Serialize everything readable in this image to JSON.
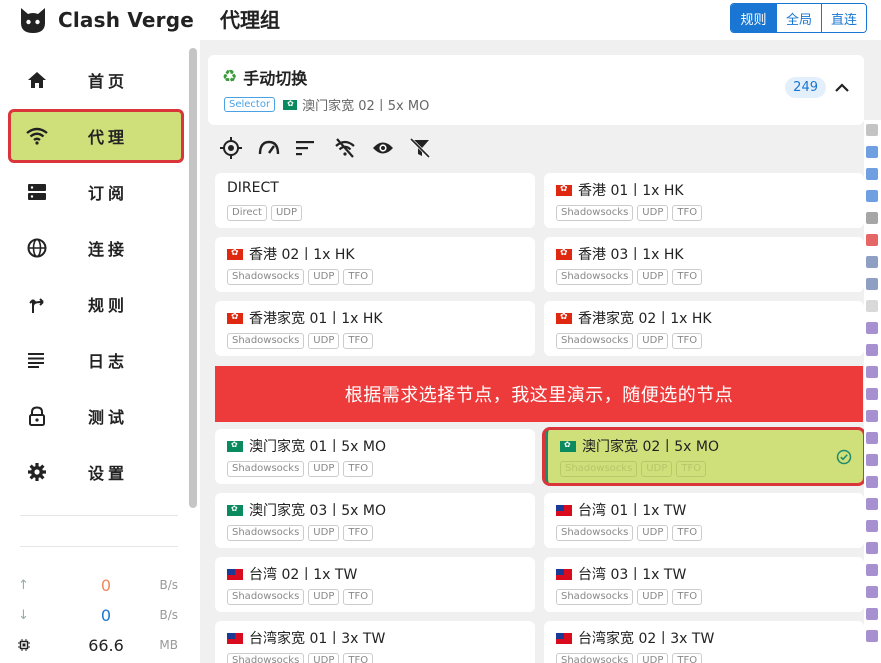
{
  "app": {
    "name": "Clash Verge"
  },
  "nav": [
    {
      "label": "首页",
      "icon": "home-icon"
    },
    {
      "label": "代理",
      "icon": "wifi-icon",
      "active": true
    },
    {
      "label": "订阅",
      "icon": "storage-icon"
    },
    {
      "label": "连接",
      "icon": "globe-icon"
    },
    {
      "label": "规则",
      "icon": "fork-icon"
    },
    {
      "label": "日志",
      "icon": "list-icon"
    },
    {
      "label": "测试",
      "icon": "lock-icon"
    },
    {
      "label": "设置",
      "icon": "gear-icon"
    }
  ],
  "stats": {
    "upload": {
      "value": "0",
      "unit": "B/s",
      "color": "#f08a5d"
    },
    "download": {
      "value": "0",
      "unit": "B/s",
      "color": "#1976d2"
    },
    "memory": {
      "value": "66.6",
      "unit": "MB"
    }
  },
  "header": {
    "title": "代理组",
    "modes": [
      {
        "label": "规则",
        "selected": true
      },
      {
        "label": "全局",
        "selected": false
      },
      {
        "label": "直连",
        "selected": false
      }
    ]
  },
  "group": {
    "name": "手动切换",
    "type": "Selector",
    "current": "澳门家宽 02丨5x MO",
    "count": "249"
  },
  "banner": "根据需求选择节点，我这里演示，随便选的节点",
  "nodes": [
    {
      "name": "DIRECT",
      "flag": "",
      "tags": [
        "Direct",
        "UDP"
      ]
    },
    {
      "name": "香港 01丨1x HK",
      "flag": "hk",
      "tags": [
        "Shadowsocks",
        "UDP",
        "TFO"
      ]
    },
    {
      "name": "香港 02丨1x HK",
      "flag": "hk",
      "tags": [
        "Shadowsocks",
        "UDP",
        "TFO"
      ]
    },
    {
      "name": "香港 03丨1x HK",
      "flag": "hk",
      "tags": [
        "Shadowsocks",
        "UDP",
        "TFO"
      ]
    },
    {
      "name": "香港家宽 01丨1x HK",
      "flag": "hk",
      "tags": [
        "Shadowsocks",
        "UDP",
        "TFO"
      ]
    },
    {
      "name": "香港家宽 02丨1x HK",
      "flag": "hk",
      "tags": [
        "Shadowsocks",
        "UDP",
        "TFO"
      ]
    },
    {
      "name": "澳门家宽 01丨5x MO",
      "flag": "mo",
      "tags": [
        "Shadowsocks",
        "UDP",
        "TFO"
      ]
    },
    {
      "name": "澳门家宽 02丨5x MO",
      "flag": "mo",
      "tags": [
        "Shadowsocks",
        "UDP",
        "TFO"
      ],
      "selected": true
    },
    {
      "name": "澳门家宽 03丨5x MO",
      "flag": "mo",
      "tags": [
        "Shadowsocks",
        "UDP",
        "TFO"
      ]
    },
    {
      "name": "台湾 01丨1x TW",
      "flag": "tw",
      "tags": [
        "Shadowsocks",
        "UDP",
        "TFO"
      ]
    },
    {
      "name": "台湾 02丨1x TW",
      "flag": "tw",
      "tags": [
        "Shadowsocks",
        "UDP",
        "TFO"
      ]
    },
    {
      "name": "台湾 03丨1x TW",
      "flag": "tw",
      "tags": [
        "Shadowsocks",
        "UDP",
        "TFO"
      ]
    },
    {
      "name": "台湾家宽 01丨3x TW",
      "flag": "tw",
      "tags": [
        "Shadowsocks",
        "UDP",
        "TFO"
      ]
    },
    {
      "name": "台湾家宽 02丨3x TW",
      "flag": "tw",
      "tags": [
        "Shadowsocks",
        "UDP",
        "TFO"
      ]
    }
  ],
  "colors": {
    "accent": "#1976d2",
    "active_nav": "#cfe07a",
    "highlight_border": "#d9353b",
    "banner": "#ed3b3b"
  }
}
